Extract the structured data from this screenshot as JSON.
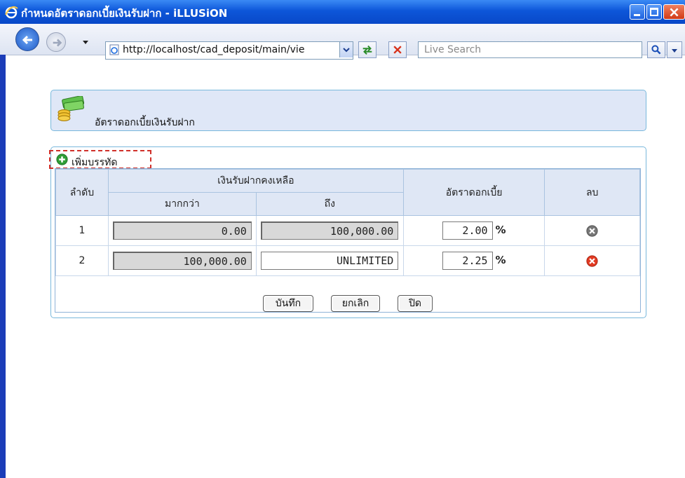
{
  "window": {
    "title": "กำหนดอัตราดอกเบี้ยเงินรับฝาก - iLLUSiON"
  },
  "browser": {
    "url": "http://localhost/cad_deposit/main/vie",
    "search_placeholder": "Live Search"
  },
  "page": {
    "header_title": "อัตราดอกเบี้ยเงินรับฝาก",
    "add_row_label": "เพิ่มบรรทัด",
    "table": {
      "col_seq": "ลำดับ",
      "col_balance_group": "เงินรับฝากคงเหลือ",
      "col_from": "มากกว่า",
      "col_to": "ถึง",
      "col_rate": "อัตราดอกเบี้ย",
      "col_delete": "ลบ",
      "rows": [
        {
          "seq": "1",
          "from": "0.00",
          "to": "100,000.00",
          "rate": "2.00",
          "pct": "%"
        },
        {
          "seq": "2",
          "from": "100,000.00",
          "to": "UNLIMITED",
          "rate": "2.25",
          "pct": "%"
        }
      ]
    },
    "buttons": {
      "save": "บันทึก",
      "cancel": "ยกเลิก",
      "close": "ปิด"
    }
  },
  "colors": {
    "titlebar": "#0d56d9",
    "panel_bg": "#dfe7f7",
    "panel_border": "#79b8dc",
    "delete_active": "#e23a22",
    "delete_inactive": "#777777"
  }
}
